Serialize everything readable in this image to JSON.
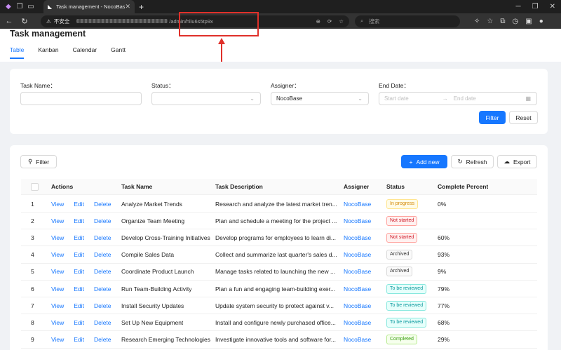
{
  "browser": {
    "tab_title": "Task management - NocoBase",
    "insecure_label": "不安全",
    "url_tail": "/admin/hliu6s5tp9x",
    "search_placeholder": "搜索"
  },
  "page": {
    "title": "Task management",
    "tabs": [
      {
        "label": "Table",
        "active": true
      },
      {
        "label": "Kanban",
        "active": false
      },
      {
        "label": "Calendar",
        "active": false
      },
      {
        "label": "Gantt",
        "active": false
      }
    ]
  },
  "filter_form": {
    "task_name_label": "Task Name",
    "status_label": "Status",
    "assigner_label": "Assigner",
    "assigner_value": "NocoBase",
    "end_date_label": "End Date",
    "start_placeholder": "Start date",
    "end_placeholder": "End date",
    "filter_button": "Filter",
    "reset_button": "Reset"
  },
  "table_toolbar": {
    "filter_button": "Filter",
    "add_new_button": "Add new",
    "refresh_button": "Refresh",
    "export_button": "Export"
  },
  "table": {
    "columns": [
      "Actions",
      "Task Name",
      "Task Description",
      "Assigner",
      "Status",
      "Complete Percent"
    ],
    "actions": {
      "view": "View",
      "edit": "Edit",
      "delete": "Delete"
    },
    "rows": [
      {
        "index": "1",
        "name": "Analyze Market Trends",
        "description": "Research and analyze the latest market tren...",
        "assigner": "NocoBase",
        "status": "In progress",
        "status_kind": "inprogress",
        "percent": "0%"
      },
      {
        "index": "2",
        "name": "Organize Team Meeting",
        "description": "Plan and schedule a meeting for the project ...",
        "assigner": "NocoBase",
        "status": "Not started",
        "status_kind": "notstarted",
        "percent": ""
      },
      {
        "index": "3",
        "name": "Develop Cross-Training Initiatives",
        "description": "Develop programs for employees to learn di...",
        "assigner": "NocoBase",
        "status": "Not started",
        "status_kind": "notstarted",
        "percent": "60%"
      },
      {
        "index": "4",
        "name": "Compile Sales Data",
        "description": "Collect and summarize last quarter's sales d...",
        "assigner": "NocoBase",
        "status": "Archived",
        "status_kind": "archived",
        "percent": "93%"
      },
      {
        "index": "5",
        "name": "Coordinate Product Launch",
        "description": "Manage tasks related to launching the new ...",
        "assigner": "NocoBase",
        "status": "Archived",
        "status_kind": "archived",
        "percent": "9%"
      },
      {
        "index": "6",
        "name": "Run Team-Building Activity",
        "description": "Plan a fun and engaging team-building exer...",
        "assigner": "NocoBase",
        "status": "To be reviewed",
        "status_kind": "reviewed",
        "percent": "79%"
      },
      {
        "index": "7",
        "name": "Install Security Updates",
        "description": "Update system security to protect against v...",
        "assigner": "NocoBase",
        "status": "To be reviewed",
        "status_kind": "reviewed",
        "percent": "77%"
      },
      {
        "index": "8",
        "name": "Set Up New Equipment",
        "description": "Install and configure newly purchased office...",
        "assigner": "NocoBase",
        "status": "To be reviewed",
        "status_kind": "reviewed",
        "percent": "68%"
      },
      {
        "index": "9",
        "name": "Research Emerging Technologies",
        "description": "Investigate innovative tools and software for...",
        "assigner": "NocoBase",
        "status": "Completed",
        "status_kind": "completed",
        "percent": "29%"
      }
    ]
  }
}
